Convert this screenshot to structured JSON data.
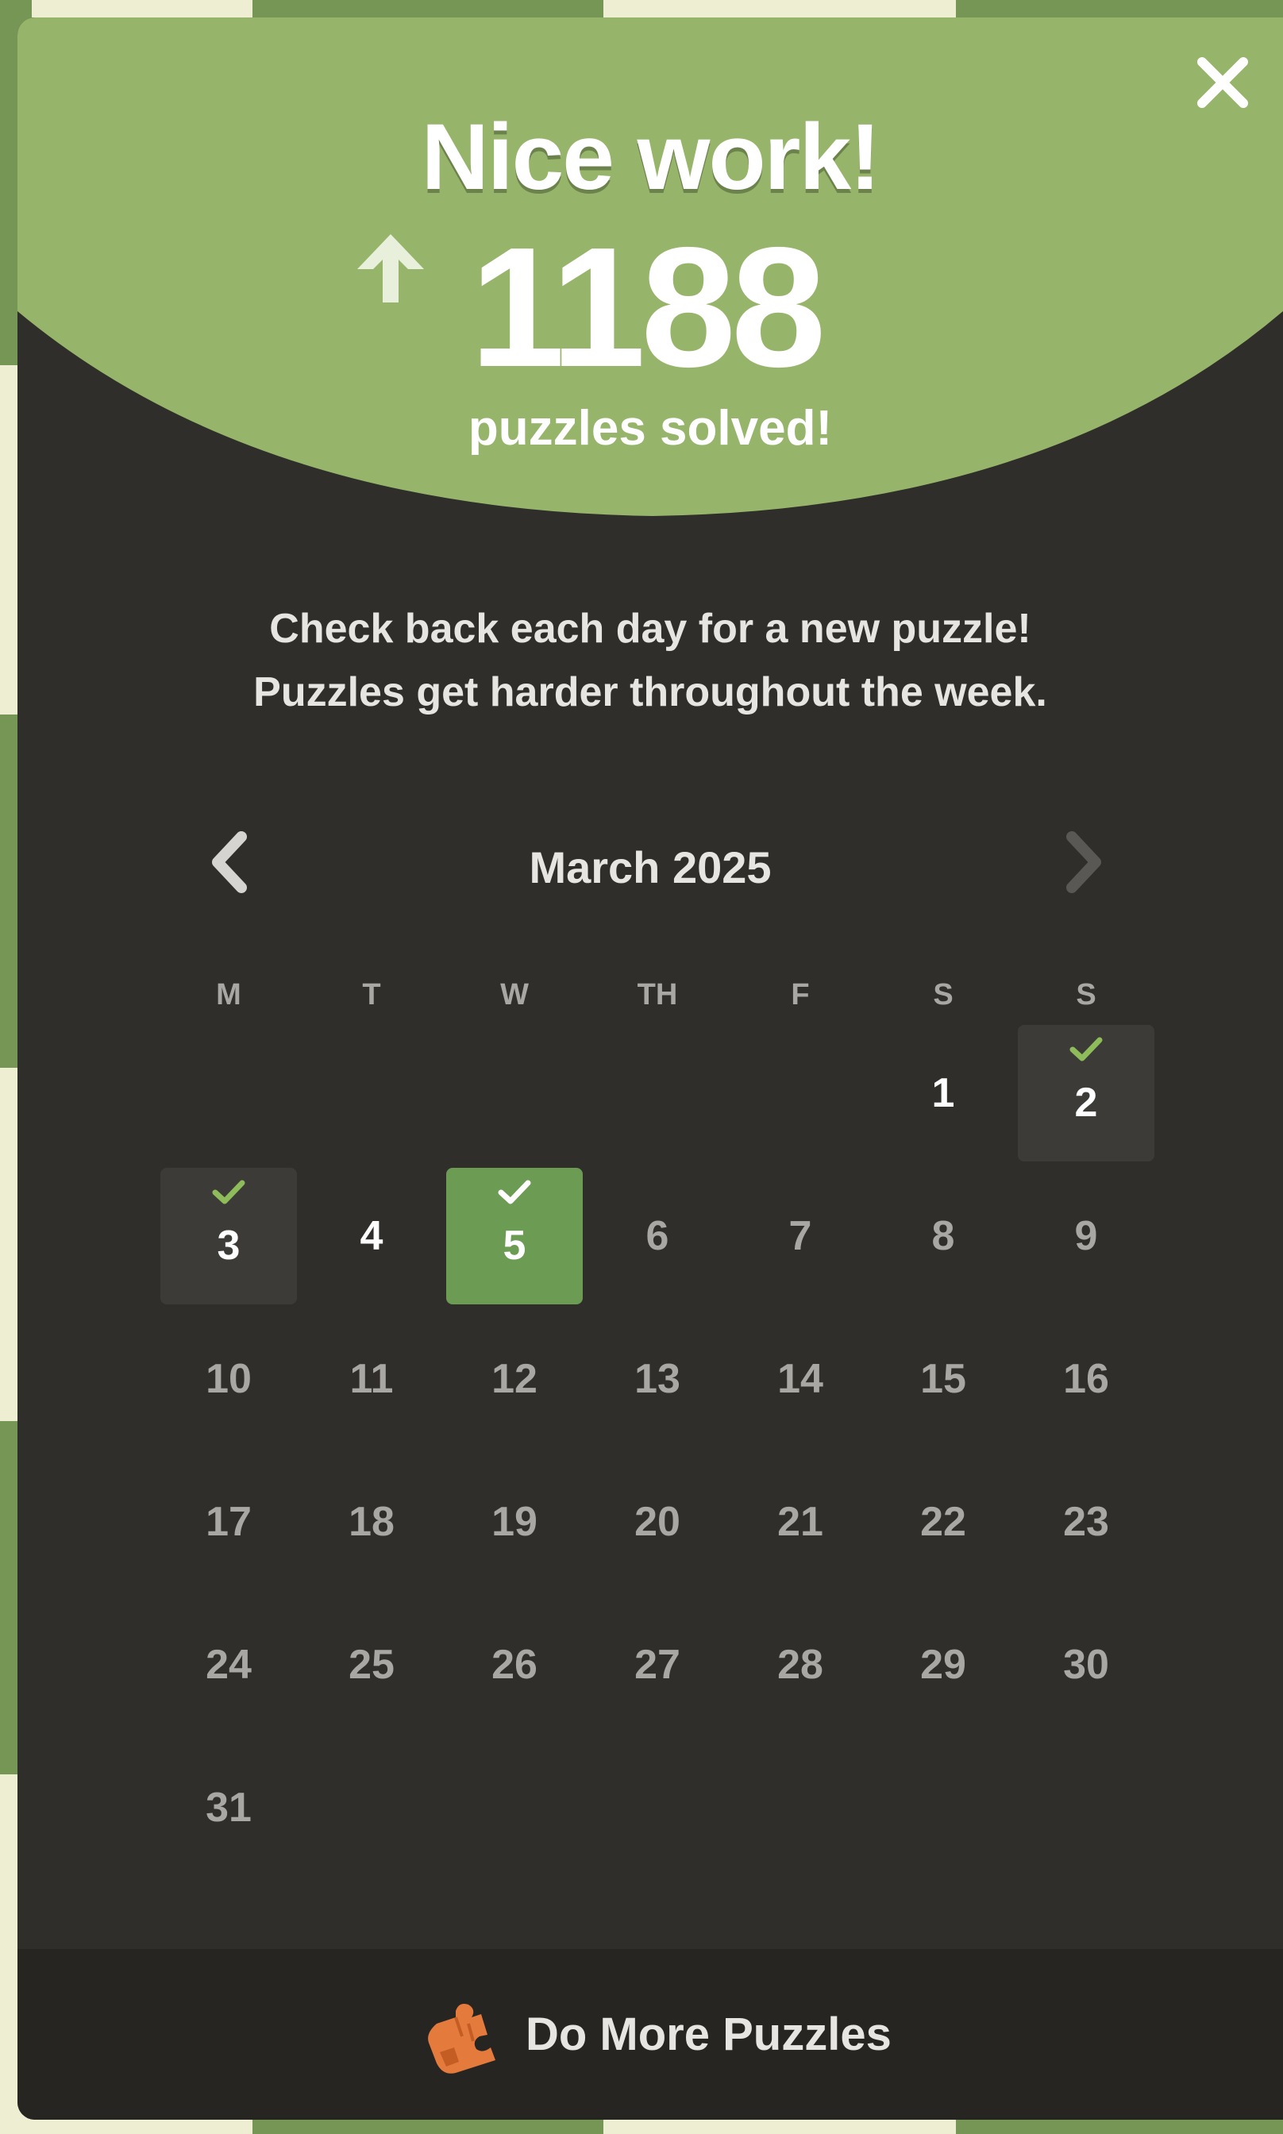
{
  "colors": {
    "hero_green": "#96b56a",
    "modal_bg": "#302e2b",
    "footer_bg": "#272522",
    "today_green": "#6c9b53",
    "check_green": "#8fbc5a",
    "muted_text": "#a9a7a3",
    "puzzle_orange": "#e57a3d"
  },
  "modal": {
    "title": "Nice work!",
    "count": "1188",
    "count_label": "puzzles solved!",
    "info_line1": "Check back each day for a new puzzle!",
    "info_line2": "Puzzles get harder throughout the week.",
    "close_icon": "close-icon",
    "arrow_icon": "arrow-up-icon"
  },
  "calendar": {
    "month_label": "March 2025",
    "prev_icon": "chevron-left-icon",
    "next_icon": "chevron-right-icon",
    "next_disabled": true,
    "weekdays": [
      "M",
      "T",
      "W",
      "TH",
      "F",
      "S",
      "S"
    ],
    "first_weekday_index": 5,
    "days": [
      {
        "label": "1",
        "state": "available",
        "solved": false
      },
      {
        "label": "2",
        "state": "available",
        "solved": true
      },
      {
        "label": "3",
        "state": "available",
        "solved": true
      },
      {
        "label": "4",
        "state": "available",
        "solved": false
      },
      {
        "label": "5",
        "state": "today",
        "solved": true
      },
      {
        "label": "6",
        "state": "future",
        "solved": false
      },
      {
        "label": "7",
        "state": "future",
        "solved": false
      },
      {
        "label": "8",
        "state": "future",
        "solved": false
      },
      {
        "label": "9",
        "state": "future",
        "solved": false
      },
      {
        "label": "10",
        "state": "future",
        "solved": false
      },
      {
        "label": "11",
        "state": "future",
        "solved": false
      },
      {
        "label": "12",
        "state": "future",
        "solved": false
      },
      {
        "label": "13",
        "state": "future",
        "solved": false
      },
      {
        "label": "14",
        "state": "future",
        "solved": false
      },
      {
        "label": "15",
        "state": "future",
        "solved": false
      },
      {
        "label": "16",
        "state": "future",
        "solved": false
      },
      {
        "label": "17",
        "state": "future",
        "solved": false
      },
      {
        "label": "18",
        "state": "future",
        "solved": false
      },
      {
        "label": "19",
        "state": "future",
        "solved": false
      },
      {
        "label": "20",
        "state": "future",
        "solved": false
      },
      {
        "label": "21",
        "state": "future",
        "solved": false
      },
      {
        "label": "22",
        "state": "future",
        "solved": false
      },
      {
        "label": "23",
        "state": "future",
        "solved": false
      },
      {
        "label": "24",
        "state": "future",
        "solved": false
      },
      {
        "label": "25",
        "state": "future",
        "solved": false
      },
      {
        "label": "26",
        "state": "future",
        "solved": false
      },
      {
        "label": "27",
        "state": "future",
        "solved": false
      },
      {
        "label": "28",
        "state": "future",
        "solved": false
      },
      {
        "label": "29",
        "state": "future",
        "solved": false
      },
      {
        "label": "30",
        "state": "future",
        "solved": false
      },
      {
        "label": "31",
        "state": "future",
        "solved": false
      }
    ]
  },
  "footer": {
    "label": "Do More Puzzles",
    "icon": "puzzle-piece-icon"
  }
}
